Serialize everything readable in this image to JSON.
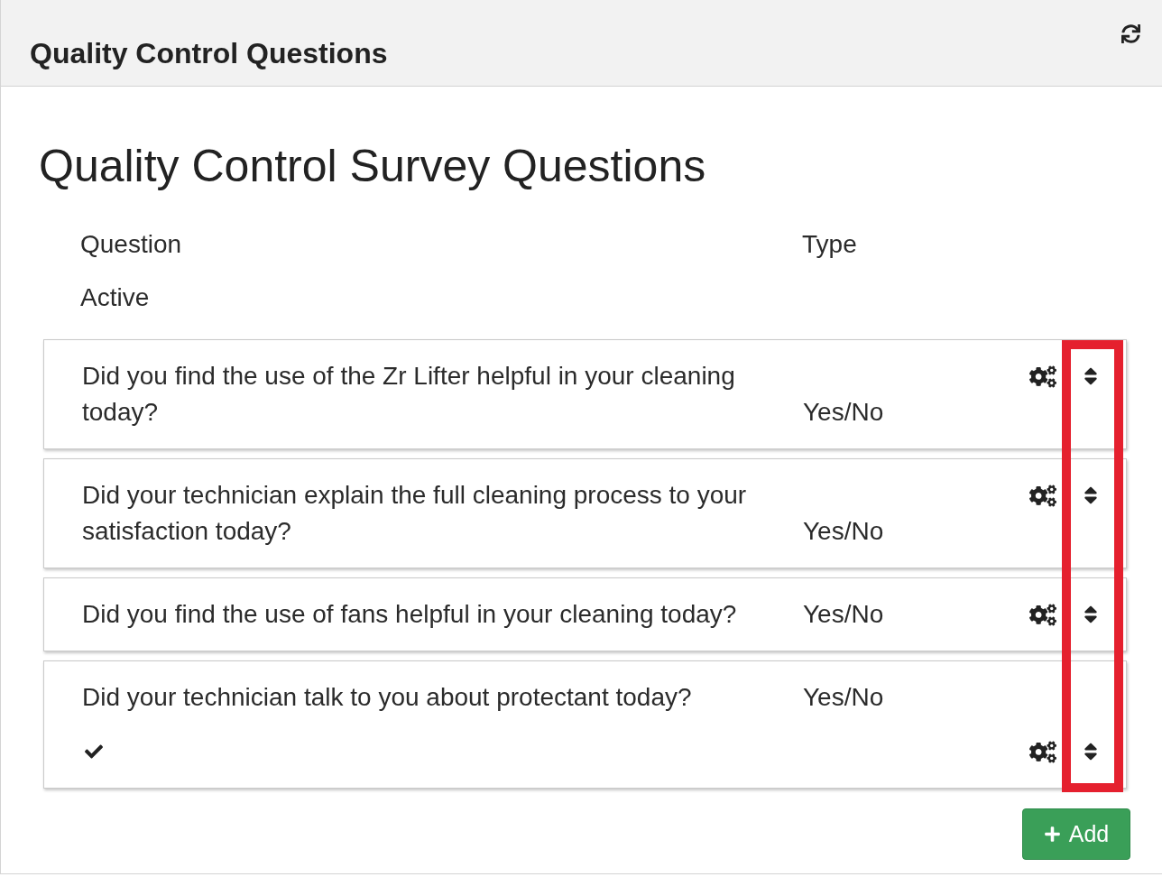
{
  "panel": {
    "title": "Quality Control Questions"
  },
  "heading": "Quality Control Survey Questions",
  "columns": [
    "Question",
    "Type",
    "Active"
  ],
  "questions": [
    {
      "text": "Did you find the use of the Zr Lifter helpful in your cleaning today?",
      "type": "Yes/No",
      "active": false
    },
    {
      "text": "Did your technician explain the full cleaning process to your satisfaction today?",
      "type": "Yes/No",
      "active": false
    },
    {
      "text": "Did you find the use of fans helpful in your cleaning today?",
      "type": "Yes/No",
      "active": false
    },
    {
      "text": "Did your technician talk to you about protectant today?",
      "type": "Yes/No",
      "active": true
    }
  ],
  "add_button": {
    "label": "Add"
  }
}
